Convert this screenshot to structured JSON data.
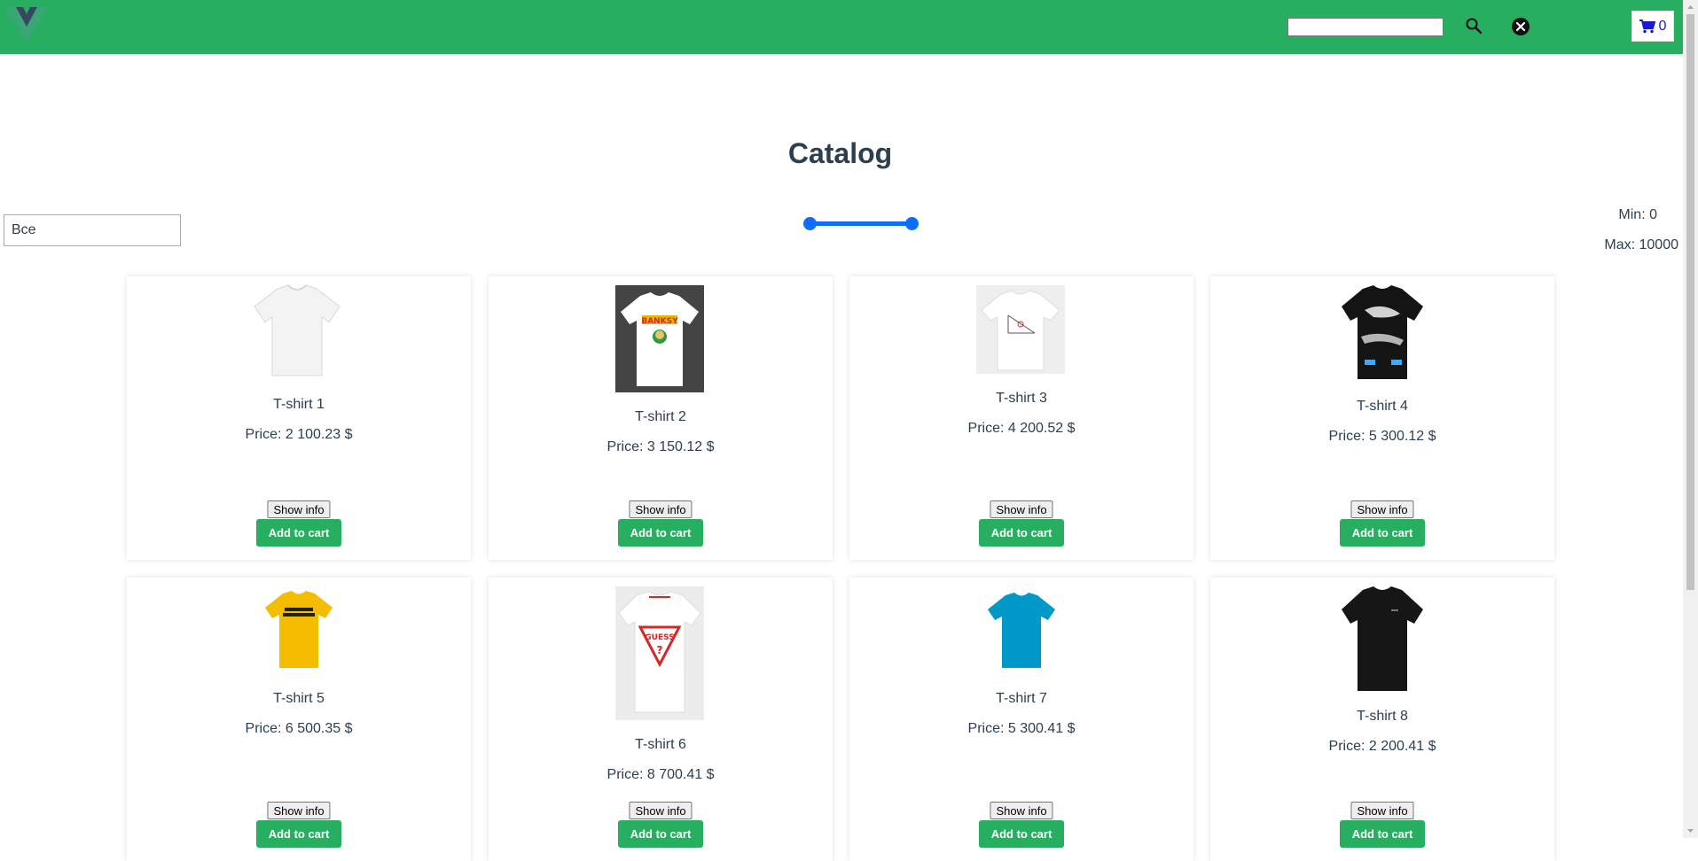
{
  "header": {
    "search": {
      "value": "",
      "placeholder": ""
    },
    "cart": {
      "count": "0"
    },
    "brand_color": "#27ae60"
  },
  "catalog": {
    "title": "Catalog",
    "category": "Все",
    "price_range": {
      "min_label": "Min: 0",
      "max_label": "Max: 10000",
      "min": 0,
      "max": 10000
    },
    "products": [
      {
        "name": "T-shirt 1",
        "price": "Price: 2 100.23 $",
        "show_info": "Show info",
        "add_to_cart": "Add to cart",
        "shirt_color": "#f5f5f5"
      },
      {
        "name": "T-shirt 2",
        "price": "Price: 3 150.12 $",
        "show_info": "Show info",
        "add_to_cart": "Add to cart",
        "shirt_color": "#ffffff"
      },
      {
        "name": "T-shirt 3",
        "price": "Price: 4 200.52 $",
        "show_info": "Show info",
        "add_to_cart": "Add to cart",
        "shirt_color": "#fafafa"
      },
      {
        "name": "T-shirt 4",
        "price": "Price: 5 300.12 $",
        "show_info": "Show info",
        "add_to_cart": "Add to cart",
        "shirt_color": "#111111"
      },
      {
        "name": "T-shirt 5",
        "price": "Price: 6 500.35 $",
        "show_info": "Show info",
        "add_to_cart": "Add to cart",
        "shirt_color": "#f5bd00"
      },
      {
        "name": "T-shirt 6",
        "price": "Price: 8 700.41 $",
        "show_info": "Show info",
        "add_to_cart": "Add to cart",
        "shirt_color": "#ffffff"
      },
      {
        "name": "T-shirt 7",
        "price": "Price: 5 300.41 $",
        "show_info": "Show info",
        "add_to_cart": "Add to cart",
        "shirt_color": "#0097c9"
      },
      {
        "name": "T-shirt 8",
        "price": "Price: 2 200.41 $",
        "show_info": "Show info",
        "add_to_cart": "Add to cart",
        "shirt_color": "#161616"
      }
    ]
  }
}
